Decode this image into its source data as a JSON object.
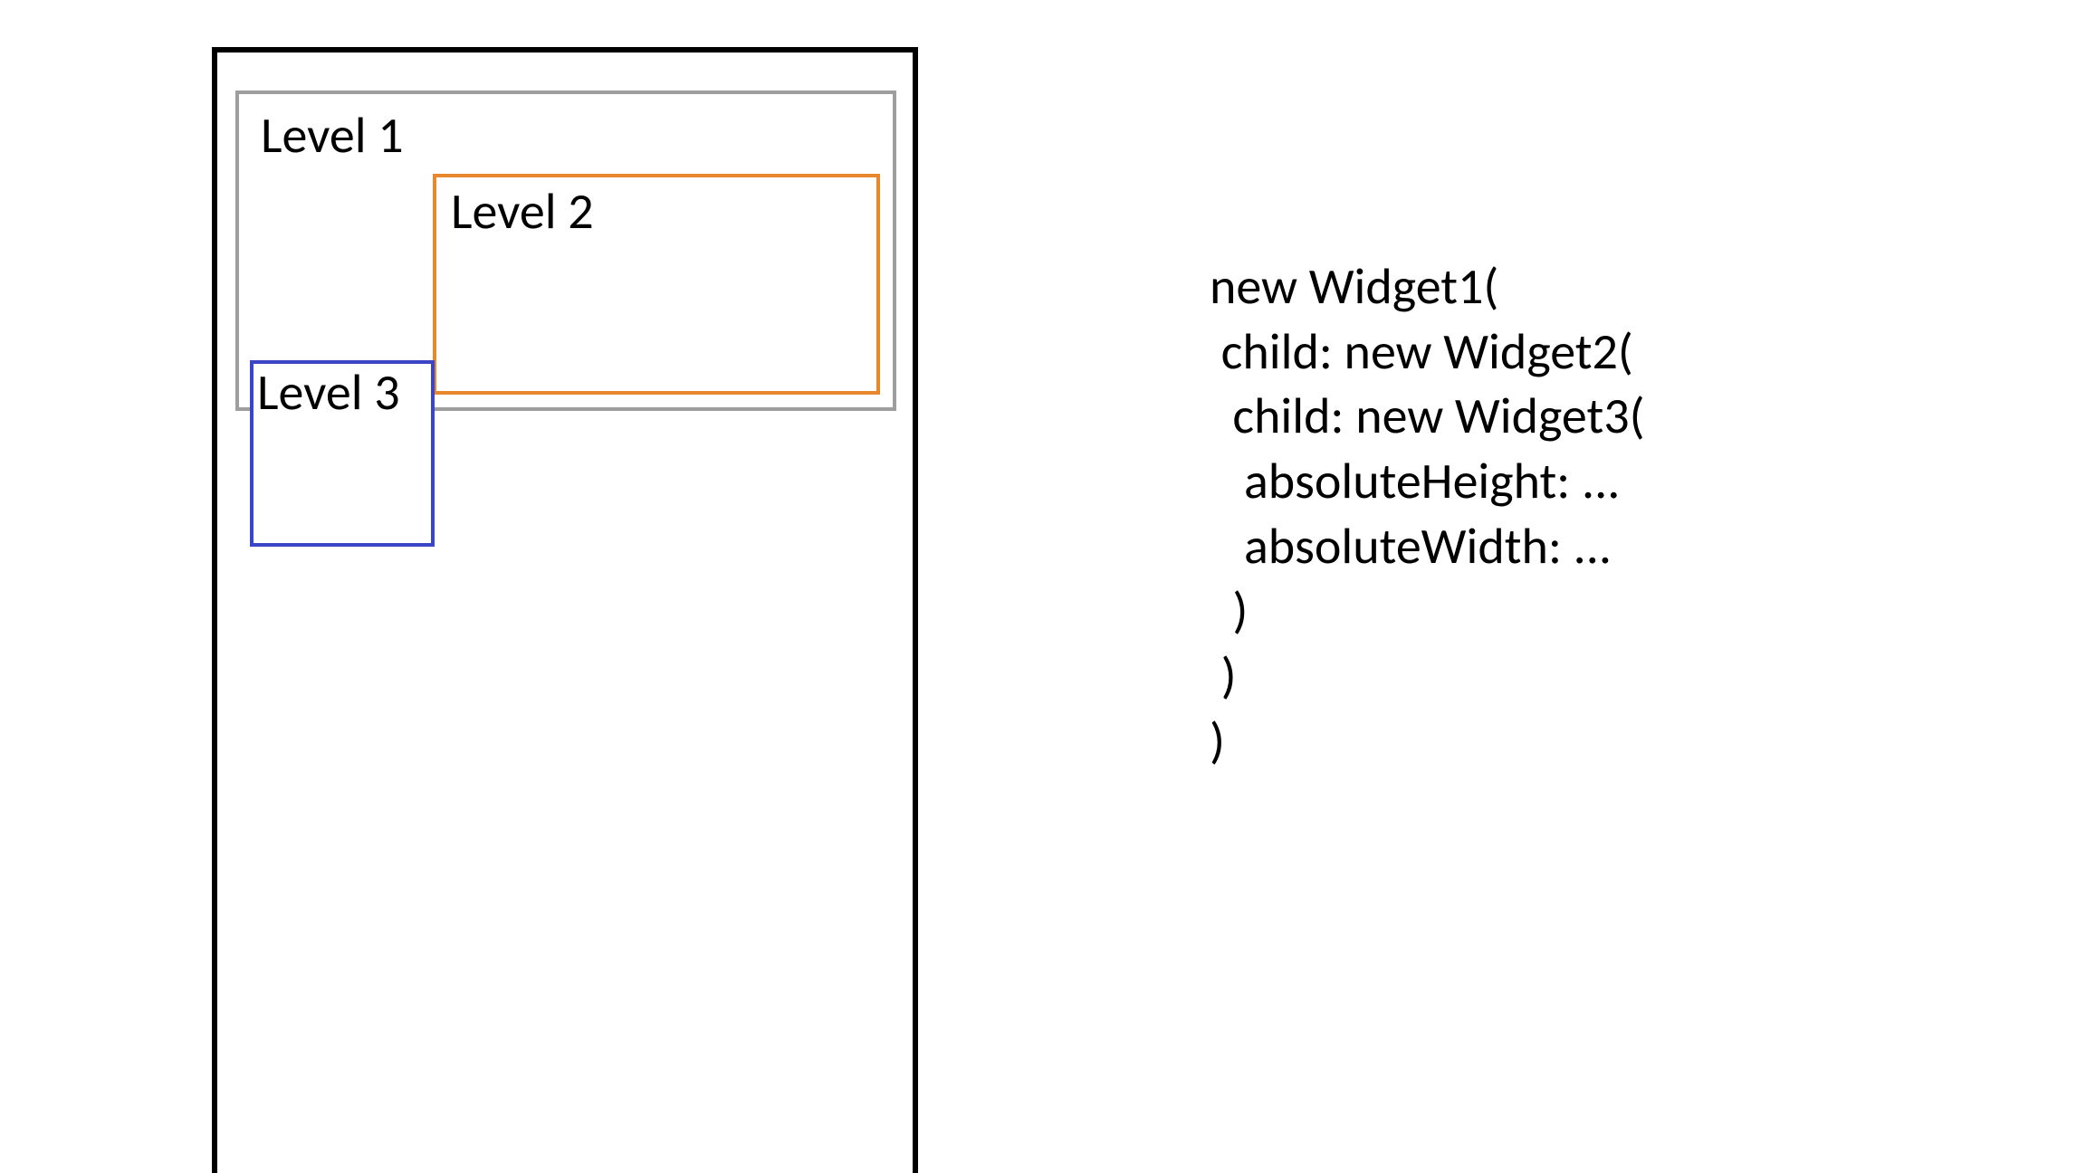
{
  "diagram": {
    "level1": "Level 1",
    "level2": "Level 2",
    "level3": "Level 3"
  },
  "code": {
    "line1": "new Widget1(",
    "line2": " child: new Widget2(",
    "line3": "  child: new Widget3(",
    "line4": "   absoluteHeight: ...",
    "line5": "   absoluteWidth: ...",
    "line6": "  )",
    "line7": " )",
    "line8": ")"
  }
}
